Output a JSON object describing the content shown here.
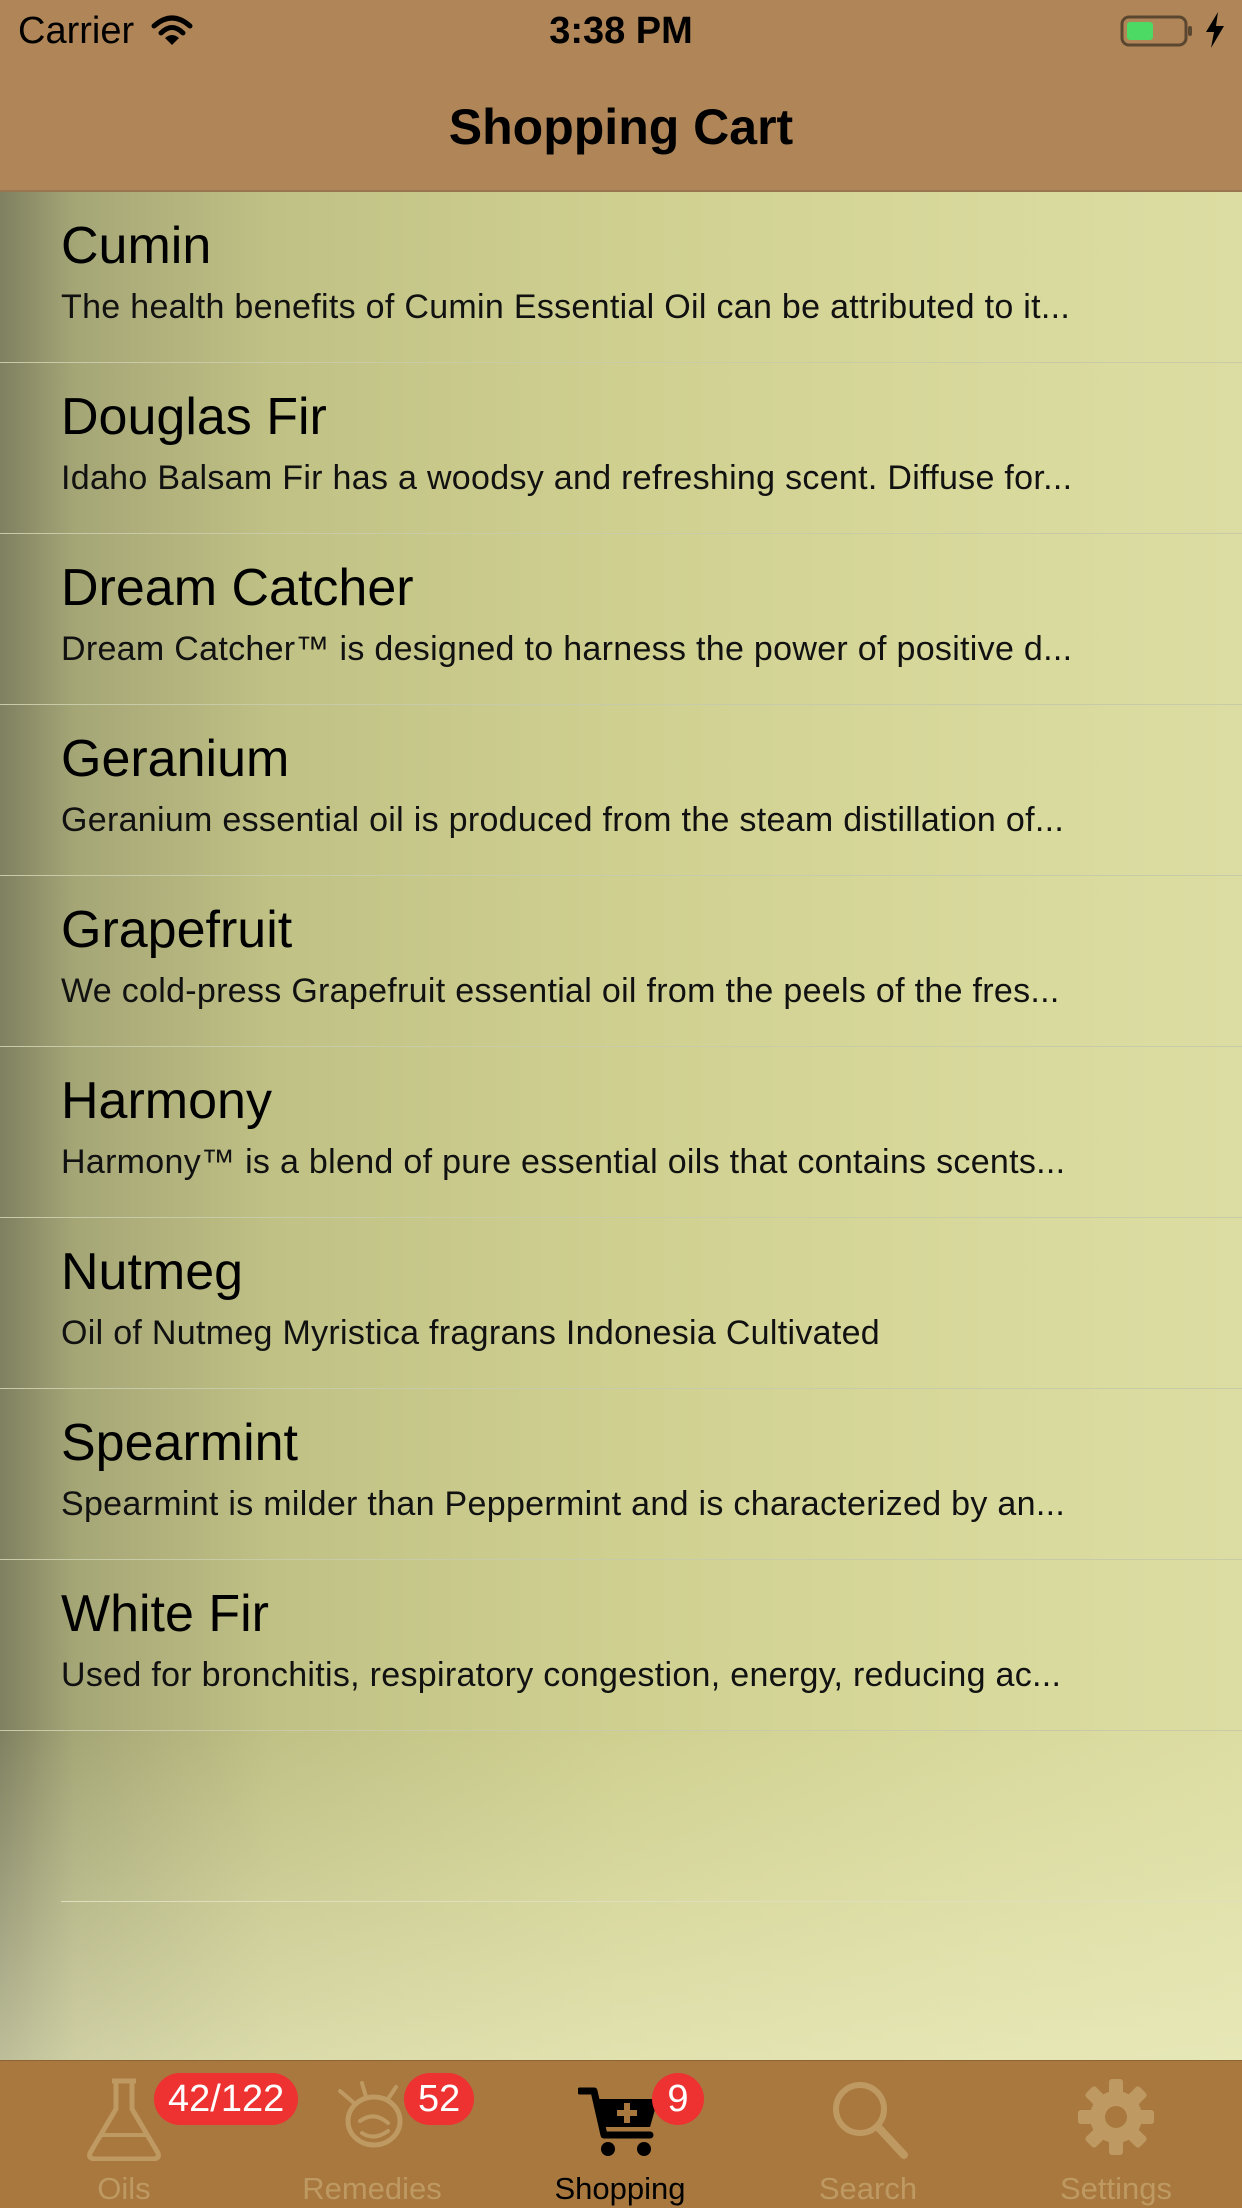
{
  "status": {
    "carrier": "Carrier",
    "time": "3:38 PM"
  },
  "nav": {
    "title": "Shopping Cart"
  },
  "items": [
    {
      "title": "Cumin",
      "subtitle": "The health benefits of Cumin Essential Oil can be attributed to it..."
    },
    {
      "title": "Douglas Fir",
      "subtitle": "Idaho Balsam Fir has a woodsy and refreshing scent. Diffuse for..."
    },
    {
      "title": "Dream Catcher",
      "subtitle": "Dream Catcher™ is designed to harness the power of positive d..."
    },
    {
      "title": "Geranium",
      "subtitle": "Geranium essential oil is produced from the steam distillation of..."
    },
    {
      "title": "Grapefruit",
      "subtitle": "We cold-press Grapefruit essential oil from the peels of the fres..."
    },
    {
      "title": "Harmony",
      "subtitle": "Harmony™ is a blend of pure essential oils that contains scents..."
    },
    {
      "title": "Nutmeg",
      "subtitle": "Oil of Nutmeg Myristica fragrans Indonesia Cultivated"
    },
    {
      "title": "Spearmint",
      "subtitle": "Spearmint is milder than Peppermint and is characterized by an..."
    },
    {
      "title": "White Fir",
      "subtitle": "Used for bronchitis, respiratory congestion, energy, reducing ac..."
    }
  ],
  "tabs": [
    {
      "label": "Oils",
      "badge": "42/122",
      "icon": "flask-icon"
    },
    {
      "label": "Remedies",
      "badge": "52",
      "icon": "remedies-icon"
    },
    {
      "label": "Shopping",
      "badge": "9",
      "icon": "cart-add-icon"
    },
    {
      "label": "Search",
      "icon": "search-icon"
    },
    {
      "label": "Settings",
      "icon": "gear-icon"
    }
  ],
  "colors": {
    "bar": "#b08658",
    "tabbar": "#a8783f",
    "badge": "#ee3131",
    "inactive_tab": "#be9a62"
  }
}
